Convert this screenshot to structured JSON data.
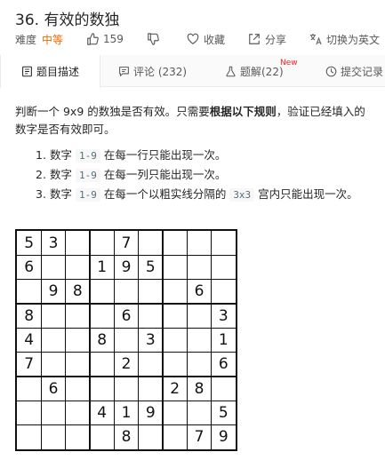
{
  "problem": {
    "title": "36. 有效的数独",
    "difficulty_label": "难度",
    "difficulty": "中等",
    "likes": "159",
    "favorite_label": "收藏",
    "share_label": "分享",
    "switch_lang_label": "切换为英文"
  },
  "tabs": [
    {
      "label": "题目描述",
      "icon": "file-text-icon"
    },
    {
      "label": "评论 (232)",
      "icon": "comment-icon"
    },
    {
      "label": "题解(22)",
      "icon": "flask-icon",
      "badge": "New"
    },
    {
      "label": "提交记录",
      "icon": "history-icon"
    }
  ],
  "description": {
    "part1": "判断一个 9x9 的数独是否有效。只需要",
    "bold": "根据以下规则",
    "part2": "，验证已经填入的数字是否有效即可。"
  },
  "rules": [
    {
      "num": "1.",
      "pre": "数字 ",
      "code": "1-9",
      "post": " 在每一行只能出现一次。"
    },
    {
      "num": "2.",
      "pre": "数字 ",
      "code": "1-9",
      "post": " 在每一列只能出现一次。"
    },
    {
      "num": "3.",
      "pre": "数字 ",
      "code": "1-9",
      "post": " 在每一个以粗实线分隔的 ",
      "code2": "3x3",
      "post2": " 宫内只能出现一次。"
    }
  ],
  "board": [
    [
      "5",
      "3",
      "",
      "",
      "7",
      "",
      "",
      "",
      ""
    ],
    [
      "6",
      "",
      "",
      "1",
      "9",
      "5",
      "",
      "",
      ""
    ],
    [
      "",
      "9",
      "8",
      "",
      "",
      "",
      "",
      "6",
      ""
    ],
    [
      "8",
      "",
      "",
      "",
      "6",
      "",
      "",
      "",
      "3"
    ],
    [
      "4",
      "",
      "",
      "8",
      "",
      "3",
      "",
      "",
      "1"
    ],
    [
      "7",
      "",
      "",
      "",
      "2",
      "",
      "",
      "",
      "6"
    ],
    [
      "",
      "6",
      "",
      "",
      "",
      "",
      "2",
      "8",
      ""
    ],
    [
      "",
      "",
      "",
      "4",
      "1",
      "9",
      "",
      "",
      "5"
    ],
    [
      "",
      "",
      "",
      "",
      "8",
      "",
      "",
      "7",
      "9"
    ]
  ]
}
